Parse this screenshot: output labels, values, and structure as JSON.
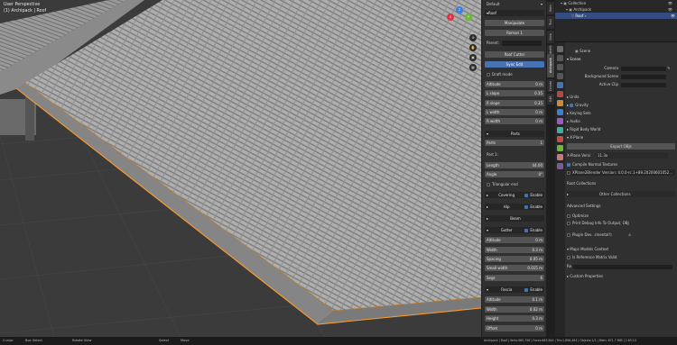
{
  "viewport": {
    "title_line1": "User Perspective",
    "title_line2": "(1) Archipack | Roof"
  },
  "gizmo": {
    "x": "X",
    "y": "Y",
    "z": "Z"
  },
  "npanel": {
    "top_label": "Default",
    "header": "Roof",
    "manipulate": "Manipulate",
    "preset": "Roman 1",
    "parent_label": "Parent:",
    "roof_cutter": "Roof Cutter",
    "sync_edit": "Sync Edit",
    "draft_mode": "Draft mode",
    "fields": [
      {
        "label": "Altitude",
        "value": "0 m"
      },
      {
        "label": "L slope",
        "value": "0.35"
      },
      {
        "label": "R slope",
        "value": "0.35"
      },
      {
        "label": "L width",
        "value": "0 m"
      },
      {
        "label": "R width",
        "value": "0 m"
      }
    ],
    "parts_header": "Parts",
    "parts_field": {
      "label": "Parts",
      "value": "1"
    },
    "part_label": "Part 1:",
    "length": {
      "label": "Length",
      "value": "44.00"
    },
    "angle": {
      "label": "Angle",
      "value": "0°"
    },
    "triangular": "Triangular end",
    "sections": [
      {
        "name": "Covering",
        "toggle": "Enable"
      },
      {
        "name": "Hip",
        "toggle": "Enable"
      },
      {
        "name": "Beam",
        "toggle": ""
      },
      {
        "name": "Gutter",
        "toggle": "Enable"
      }
    ],
    "gutter_fields": [
      {
        "label": "Altitude",
        "value": "0 m"
      },
      {
        "label": "Width",
        "value": "0.3 m"
      },
      {
        "label": "Spacing",
        "value": "0.05 m"
      },
      {
        "label": "Small width",
        "value": "0.015 m"
      },
      {
        "label": "Segs",
        "value": "6"
      }
    ],
    "fascia": {
      "name": "Fascia",
      "toggle": "Enable"
    },
    "fascia_fields": [
      {
        "label": "Altitude",
        "value": "0.1 m"
      },
      {
        "label": "Width",
        "value": "0.02 m"
      },
      {
        "label": "Height",
        "value": "0.3 m"
      },
      {
        "label": "Offset",
        "value": "0 m"
      }
    ]
  },
  "ntabs": [
    "Item",
    "Tool",
    "View",
    "BlenderKit",
    "Archipack",
    "Create",
    "Edit"
  ],
  "outliner": [
    {
      "name": "Collection",
      "indent": 0
    },
    {
      "name": "Archipack",
      "indent": 1
    },
    {
      "name": "Roof",
      "indent": 2,
      "selected": true
    }
  ],
  "props": {
    "scene_name": "Scene",
    "scene_header": "Scene",
    "camera": "Camera",
    "background": "Background Scene",
    "active_clip": "Active Clip",
    "units": "Units",
    "gravity": "Gravity",
    "keying": "Keying Sets",
    "audio": "Audio",
    "rigid": "Rigid Body World",
    "xplane": "X-Plane",
    "export_obj": "Export OBJs",
    "xplane_version_label": "X-Plane Versi",
    "xplane_version_value": "11.3x",
    "compile_normal": "Compile Normal Textures",
    "xplane_info": "XPlane2Blender Version: 4.0.0-rc.1+89.20200601052...",
    "root_collections": "Root Collections",
    "other_collections": "Other Collections",
    "advanced": "Advanced Settings",
    "optimize": "Optimize",
    "debug_info": "Print Debug Info To Output, OBJ",
    "plugin_dev": "Plugin Dev...rmental!)",
    "maps_models": "Maps Models Context",
    "is_ref": "Is Reference Matrix Valid",
    "ref_label": "Re",
    "custom_props": "Custom Properties"
  },
  "status": {
    "left": [
      "Cursor",
      "Box Select",
      "Rotate View",
      "Select",
      "Move"
    ],
    "right": "Archipack | Roof | Verts:960,756 | Faces:863,644 | Tris:1,896,464 | Objects:1/1 | Mem: 871.7 MiB | 2.83.10"
  },
  "colors": {
    "accent": "#4772b3",
    "orange": "#ffa028",
    "selected_row": "#334d80"
  }
}
